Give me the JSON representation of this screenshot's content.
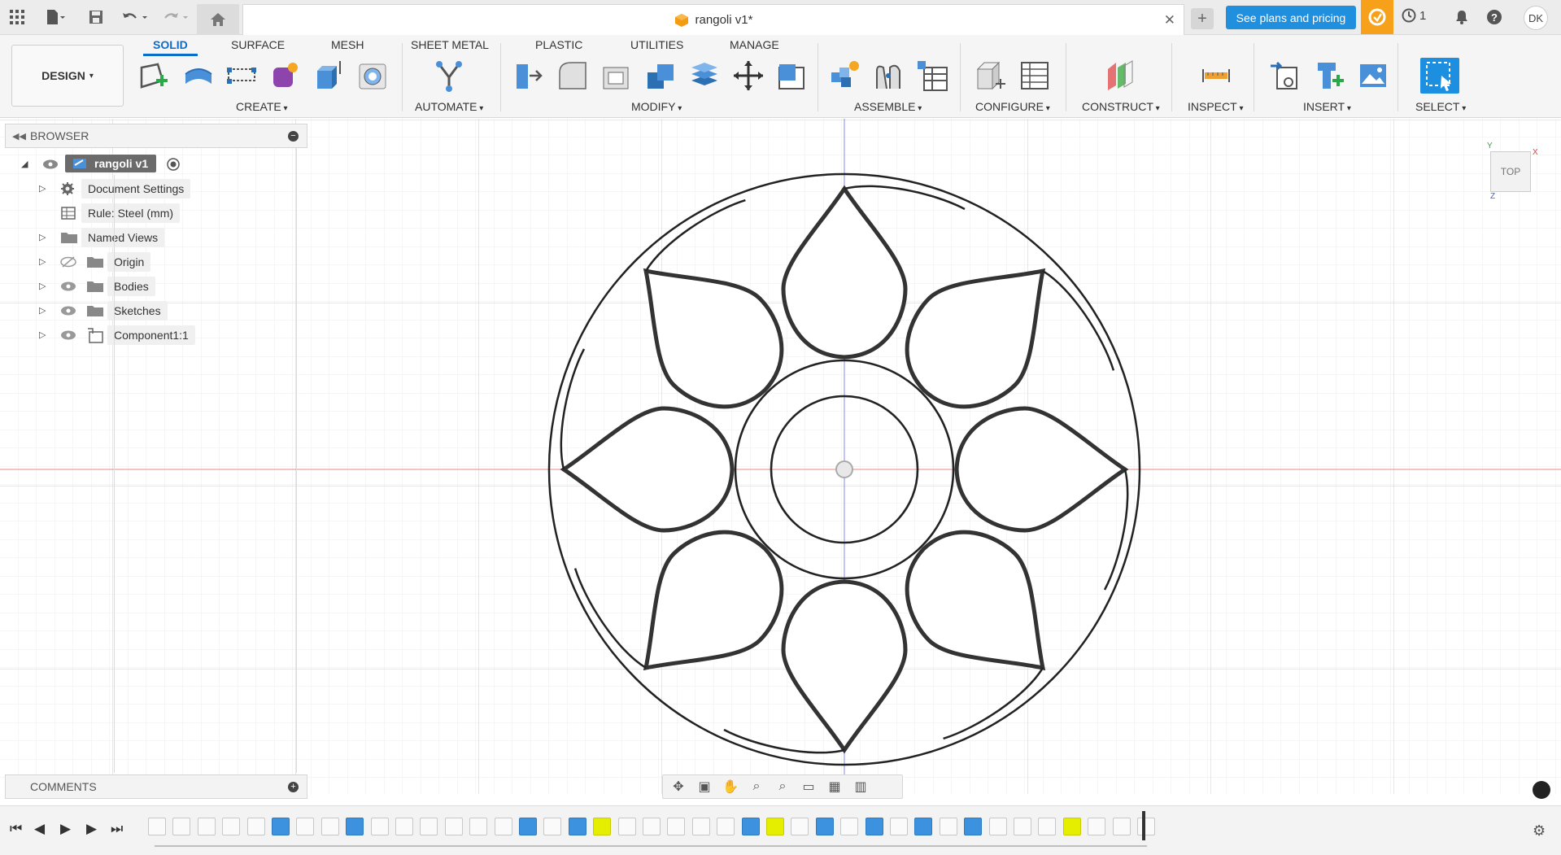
{
  "document": {
    "title": "rangoli v1*",
    "close_glyph": "✕"
  },
  "appbar": {
    "plans_button": "See plans and pricing",
    "job_count": "1",
    "user_initials": "DK",
    "new_tab_glyph": "+"
  },
  "ribbon": {
    "workspace_button": "DESIGN",
    "tabs": [
      "SOLID",
      "SURFACE",
      "MESH",
      "SHEET METAL",
      "PLASTIC",
      "UTILITIES",
      "MANAGE"
    ],
    "active_tab": "SOLID",
    "groups": [
      "CREATE",
      "AUTOMATE",
      "MODIFY",
      "ASSEMBLE",
      "CONFIGURE",
      "CONSTRUCT",
      "INSPECT",
      "INSERT",
      "SELECT"
    ]
  },
  "browser": {
    "header": "BROWSER",
    "root": "rangoli v1",
    "items": [
      "Document Settings",
      "Rule: Steel (mm)",
      "Named Views",
      "Origin",
      "Bodies",
      "Sketches",
      "Component1:1"
    ]
  },
  "comments": {
    "header": "COMMENTS"
  },
  "viewcube": {
    "face": "TOP",
    "axis_x": "X",
    "axis_y": "Y",
    "axis_z": "Z"
  },
  "timeline": {
    "controls": [
      "⏮",
      "◀",
      "▶",
      "▶",
      "⏭"
    ],
    "feature_count": 41
  },
  "colors": {
    "accent": "#0d6cc9",
    "plans_button": "#1f8fde",
    "notification": "#f7a11a",
    "timeline_highlight": "#e6ee00",
    "x_axis": "#e88a8a",
    "y_axis": "#8a8ae8"
  }
}
